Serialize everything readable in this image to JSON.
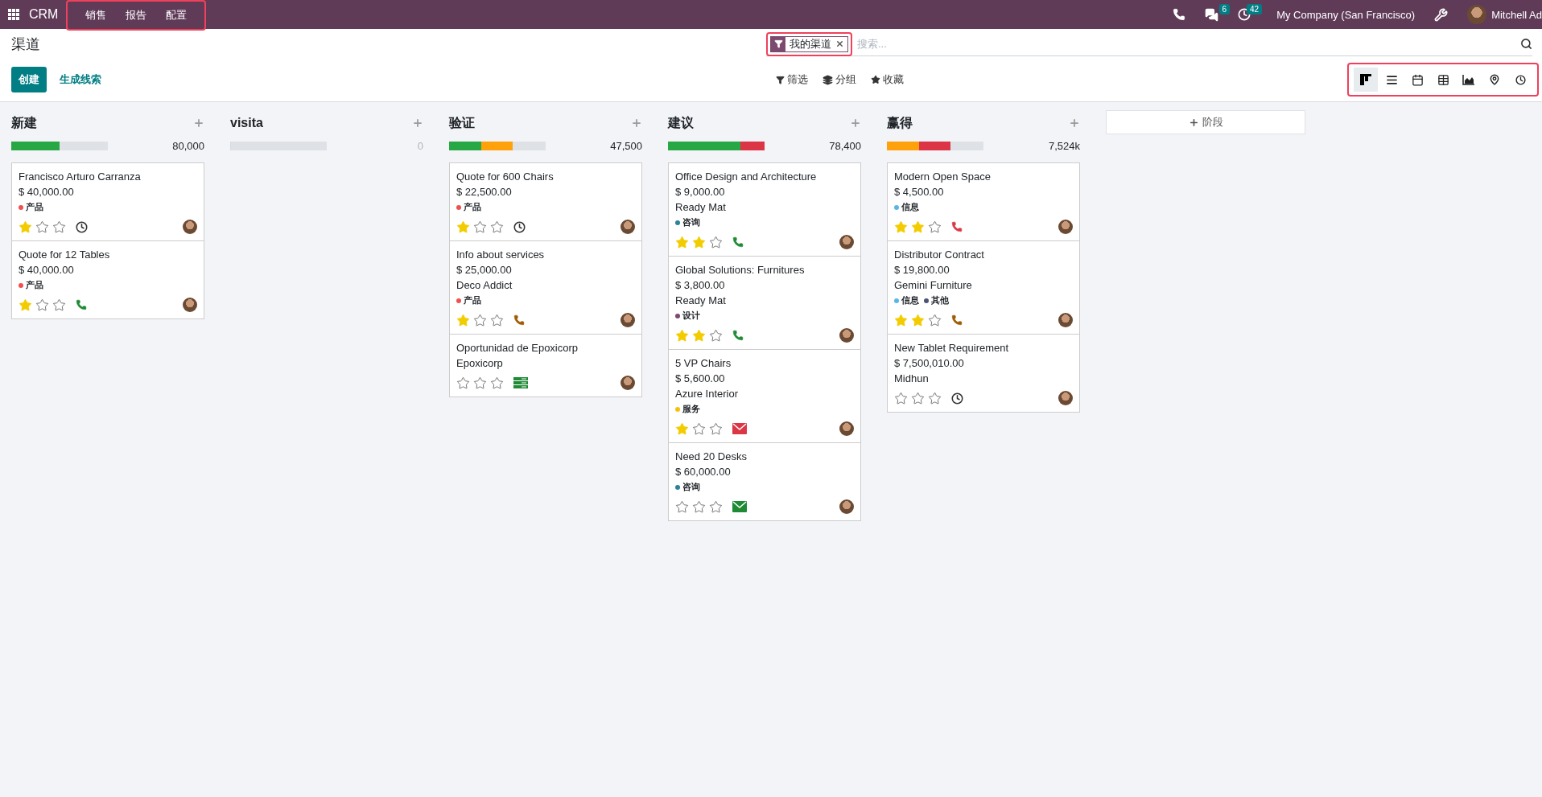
{
  "navbar": {
    "app_name": "CRM",
    "menu": [
      "销售",
      "报告",
      "配置"
    ],
    "messages_count": "6",
    "activities_count": "42",
    "company": "My Company (San Francisco)",
    "user": "Mitchell Ad"
  },
  "control_panel": {
    "title": "渠道",
    "create_button": "创建",
    "generate_button": "生成线索",
    "search": {
      "facet": "我的渠道",
      "placeholder": "搜索..."
    },
    "search_buttons": [
      {
        "kind": "filter",
        "label": "筛选"
      },
      {
        "kind": "group",
        "label": "分组"
      },
      {
        "kind": "favorite",
        "label": "收藏"
      }
    ],
    "views": [
      {
        "kind": "kanban",
        "selected": true
      },
      {
        "kind": "list",
        "selected": false
      },
      {
        "kind": "calendar",
        "selected": false
      },
      {
        "kind": "pivot",
        "selected": false
      },
      {
        "kind": "graph",
        "selected": false
      },
      {
        "kind": "map",
        "selected": false
      },
      {
        "kind": "activity",
        "selected": false
      }
    ]
  },
  "columns": [
    {
      "title": "新建",
      "total": "80,000",
      "progress": [
        {
          "level": 0.5,
          "color": "#28a745"
        }
      ],
      "cards": [
        {
          "name": "Francisco Arturo Carranza",
          "amount": "$ 40,000.00",
          "tags": [
            {
              "label": "产品",
              "color": "#f05050"
            }
          ],
          "stars": 1,
          "activity": {
            "kind": "clock"
          }
        },
        {
          "name": "Quote for 12 Tables",
          "amount": "$ 40,000.00",
          "tags": [
            {
              "label": "产品",
              "color": "#f05050"
            }
          ],
          "stars": 1,
          "activity": {
            "kind": "phone",
            "color": "#1e8a34"
          }
        }
      ]
    },
    {
      "title": "visita",
      "total": "0",
      "progress": [
        {
          "level": 0
        }
      ]
    },
    {
      "title": "验证",
      "total": "47,500",
      "progress": [
        {
          "level": 0.33,
          "color": "#28a745"
        },
        {
          "level": 0.66,
          "color": "#ffa10a"
        }
      ],
      "cards": [
        {
          "name": "Quote for 600 Chairs",
          "amount": "$ 22,500.00",
          "tags": [
            {
              "label": "产品",
              "color": "#f05050"
            }
          ],
          "stars": 1,
          "activity": {
            "kind": "clock"
          }
        },
        {
          "name": "Info about services",
          "amount": "$ 25,000.00",
          "partner": "Deco Addict",
          "tags": [
            {
              "label": "产品",
              "color": "#f05050"
            }
          ],
          "stars": 1,
          "activity": {
            "kind": "phone",
            "color": "#a05a00"
          }
        },
        {
          "name": "Oportunidad de Epoxicorp",
          "partner": "Epoxicorp",
          "stars": 0,
          "activity": {
            "kind": "tasks",
            "color": "#1e8a34"
          }
        }
      ]
    },
    {
      "title": "建议",
      "total": "78,400",
      "progress": [
        {
          "level": 0.75,
          "color": "#28a745"
        },
        {
          "level": 1,
          "color": "#dc3545"
        }
      ],
      "cards": [
        {
          "name": "Office Design and Architecture",
          "amount": "$ 9,000.00",
          "partner": "Ready Mat",
          "tags": [
            {
              "label": "咨询",
              "color": "#2c8397"
            }
          ],
          "stars": 2,
          "activity": {
            "kind": "phone",
            "color": "#1e8a34"
          }
        },
        {
          "name": "Global Solutions: Furnitures",
          "amount": "$ 3,800.00",
          "partner": "Ready Mat",
          "tags": [
            {
              "label": "设计",
              "color": "#7c4a6e"
            }
          ],
          "stars": 2,
          "activity": {
            "kind": "phone",
            "color": "#1e8a34"
          }
        },
        {
          "name": "5 VP Chairs",
          "amount": "$ 5,600.00",
          "partner": "Azure Interior",
          "tags": [
            {
              "label": "服务",
              "color": "#f4c20d"
            }
          ],
          "stars": 1,
          "activity": {
            "kind": "mail",
            "color": "#dc3545"
          }
        },
        {
          "name": "Need 20 Desks",
          "amount": "$ 60,000.00",
          "tags": [
            {
              "label": "咨询",
              "color": "#2c8397"
            }
          ],
          "stars": 0,
          "activity": {
            "kind": "mail",
            "color": "#1e8a34"
          }
        }
      ]
    },
    {
      "title": "赢得",
      "total": "7,524k",
      "progress": [
        {
          "level": 0.33,
          "color": "#ffa10a"
        },
        {
          "level": 0.66,
          "color": "#dc3545"
        }
      ],
      "cards": [
        {
          "name": "Modern Open Space",
          "amount": "$ 4,500.00",
          "tags": [
            {
              "label": "信息",
              "color": "#5bb6e8"
            }
          ],
          "stars": 2,
          "activity": {
            "kind": "phone",
            "color": "#dc3545"
          }
        },
        {
          "name": "Distributor Contract",
          "amount": "$ 19,800.00",
          "partner": "Gemini Furniture",
          "tags": [
            {
              "label": "信息",
              "color": "#5bb6e8"
            },
            {
              "label": "其他",
              "color": "#4a5278"
            }
          ],
          "stars": 2,
          "activity": {
            "kind": "phone",
            "color": "#a05a00"
          }
        },
        {
          "name": "New Tablet Requirement",
          "amount": "$ 7,500,010.00",
          "partner": "Midhun",
          "stars": 0,
          "activity": {
            "kind": "clock"
          }
        }
      ]
    }
  ],
  "add_stage_button": "阶段"
}
